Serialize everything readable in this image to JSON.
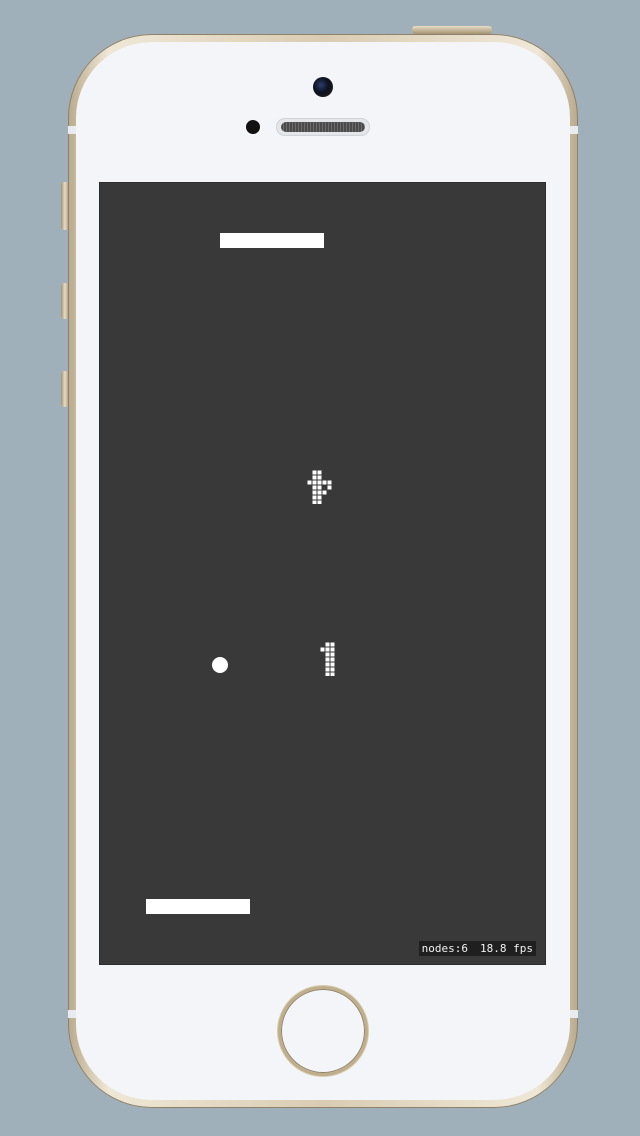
{
  "device": {
    "frame_color": "#d9ccb2",
    "face_color": "#f4f5f8",
    "background_color": "#a0b0ba"
  },
  "game": {
    "screen_color": "#393939",
    "paddle_color": "#ffffff",
    "ball_color": "#ffffff",
    "scores": {
      "opponent": 7,
      "player": 1
    }
  },
  "debug": {
    "nodes": "nodes:6",
    "fps": "18.8 fps"
  }
}
